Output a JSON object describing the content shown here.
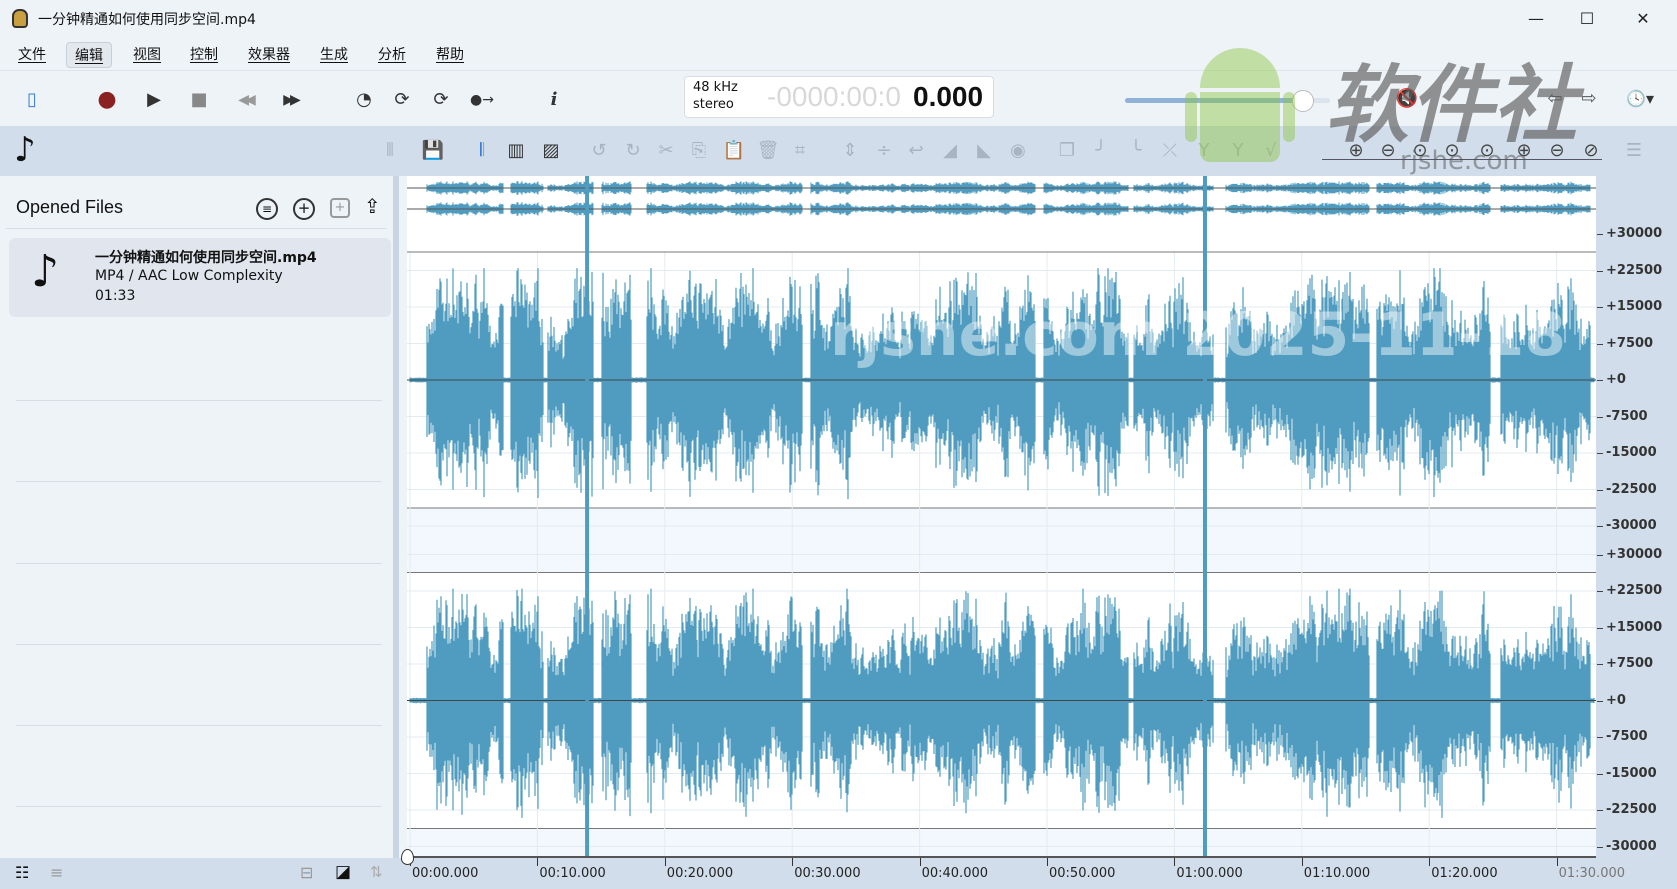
{
  "window": {
    "title": "一分钟精通如何使用同步空间.mp4",
    "minimize": "—",
    "maximize": "☐",
    "close": "✕"
  },
  "menu": [
    "文件",
    "编辑",
    "视图",
    "控制",
    "效果器",
    "生成",
    "分析",
    "帮助"
  ],
  "transport": {
    "icons": [
      "sidebar-toggle-icon",
      "record-icon",
      "play-icon",
      "stop-icon",
      "rewind-icon",
      "fast-forward-icon",
      "speed-icon",
      "loop-icon",
      "loop-add-icon",
      "follow-playhead-icon",
      "info-icon"
    ],
    "glyphs": [
      "▯",
      "●",
      "▶",
      "■",
      "◀◀",
      "▶▶",
      "◔",
      "⟳",
      "⟳",
      "●→",
      "i"
    ],
    "record_color": "#8b2222"
  },
  "time_display": {
    "sample_rate": "48 kHz",
    "channels": "stereo",
    "time_dim": "-0000:00:0",
    "time_bright": "0.000"
  },
  "volume": {
    "value": 0.87
  },
  "right_controls": {
    "glyphs": [
      "🔇",
      "⇦",
      "⇨",
      "🕓▾"
    ]
  },
  "edit_toolbar": {
    "glyphs": [
      "⦀",
      "💾",
      "𝄃",
      "▥",
      "▨",
      "↺",
      "↻",
      "✂",
      "⎘",
      "📋",
      "🗑",
      "⌗",
      "⇕",
      "÷",
      "↩",
      "◢",
      "◣",
      "◉",
      "❐",
      "╯",
      "╰",
      "⤫",
      "Y",
      "Y",
      "√",
      "⊕",
      "⊖",
      "⊙",
      "⊙",
      "⊙",
      "⊕",
      "⊖",
      "⊘",
      "☰"
    ]
  },
  "sidebar": {
    "title": "Opened Files",
    "header_icons": [
      "filter-icon",
      "add-icon",
      "duplicate-icon",
      "export-icon"
    ],
    "files": [
      {
        "name": "一分钟精通如何使用同步空间.mp4",
        "format": "MP4 / AAC Low Complexity",
        "duration": "01:33"
      }
    ]
  },
  "bottom_left": {
    "glyphs": [
      "☷",
      "≡",
      "⊟",
      "◪",
      "⇅"
    ]
  },
  "waveform": {
    "color": "#4f9cc0",
    "duration_seconds": 93,
    "y_ticks": [
      "+30000",
      "+22500",
      "+15000",
      "+7500",
      "+0",
      "-7500",
      "-15000",
      "-22500",
      "-30000"
    ],
    "time_ticks": [
      "00:00.000",
      "00:10.000",
      "00:20.000",
      "00:30.000",
      "00:40.000",
      "00:50.000",
      "01:00.000",
      "01:10.000",
      "01:20.000",
      "01:30.000"
    ]
  },
  "watermark": {
    "brand": "软件社",
    "site": "rjshe.com",
    "stamp": "rjshe.com 2025-11-18"
  }
}
